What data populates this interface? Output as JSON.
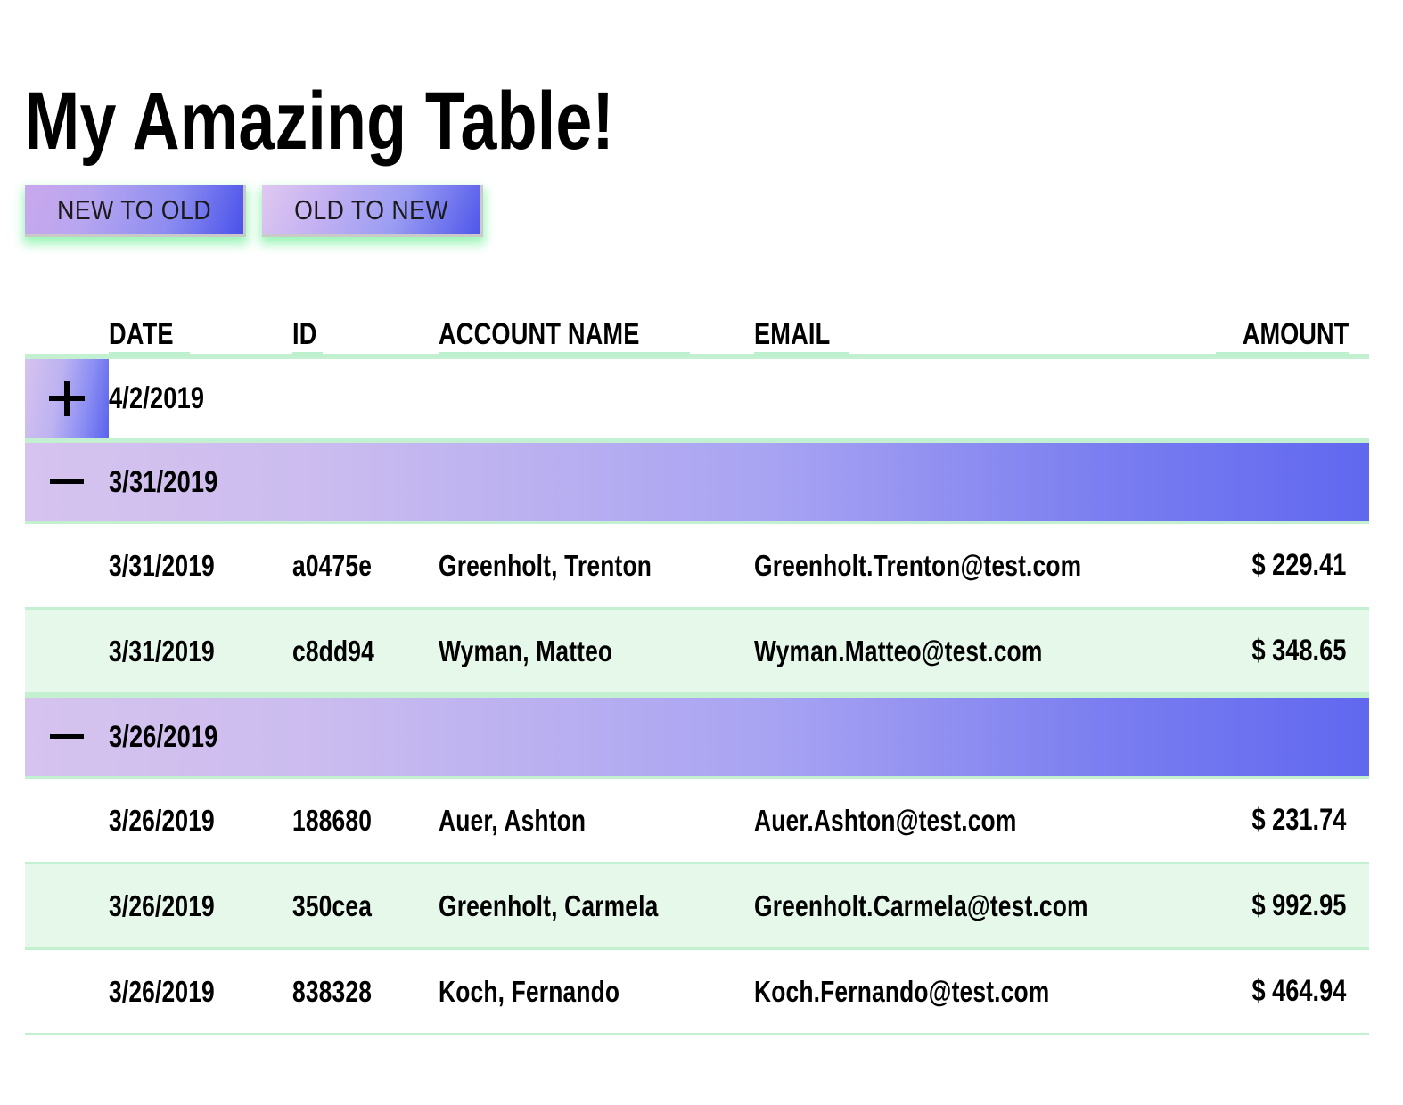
{
  "page": {
    "title": "My Amazing Table!"
  },
  "sort_controls": {
    "new_to_old_label": "NEW TO OLD",
    "old_to_new_label": "OLD TO NEW"
  },
  "table": {
    "columns": [
      {
        "key": "date",
        "label": "DATE"
      },
      {
        "key": "id",
        "label": "ID"
      },
      {
        "key": "name",
        "label": "ACCOUNT NAME"
      },
      {
        "key": "email",
        "label": "EMAIL"
      },
      {
        "key": "amount",
        "label": "AMOUNT"
      }
    ],
    "groups": [
      {
        "date": "4/2/2019",
        "expanded": false,
        "toggle_icon": "plus-icon",
        "rows": []
      },
      {
        "date": "3/31/2019",
        "expanded": true,
        "toggle_icon": "minus-icon",
        "rows": [
          {
            "date": "3/31/2019",
            "id": "a0475e",
            "name": "Greenholt, Trenton",
            "email": "Greenholt.Trenton@test.com",
            "amount": "$ 229.41"
          },
          {
            "date": "3/31/2019",
            "id": "c8dd94",
            "name": "Wyman, Matteo",
            "email": "Wyman.Matteo@test.com",
            "amount": "$ 348.65"
          }
        ]
      },
      {
        "date": "3/26/2019",
        "expanded": true,
        "toggle_icon": "minus-icon",
        "rows": [
          {
            "date": "3/26/2019",
            "id": "188680",
            "name": "Auer, Ashton",
            "email": "Auer.Ashton@test.com",
            "amount": "$ 231.74"
          },
          {
            "date": "3/26/2019",
            "id": "350cea",
            "name": "Greenholt, Carmela",
            "email": "Greenholt.Carmela@test.com",
            "amount": "$ 992.95"
          },
          {
            "date": "3/26/2019",
            "id": "838328",
            "name": "Koch, Fernando",
            "email": "Koch.Fernando@test.com",
            "amount": "$ 464.94"
          }
        ]
      }
    ]
  },
  "colors": {
    "accent_purple": "#d6c3ee",
    "accent_blue": "#5a62ed",
    "row_alt_green": "#e5f8ea",
    "border_green": "#c3f0d0",
    "underline_green": "#bdf0cc",
    "glow_green": "#7cf0a0",
    "text": "#000000"
  }
}
